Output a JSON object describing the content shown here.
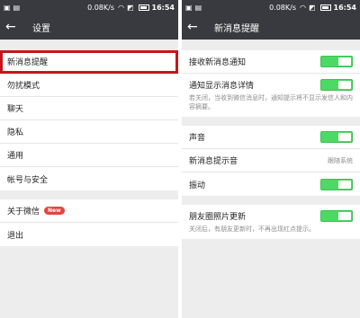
{
  "statusbar": {
    "speed": "0.08K/s",
    "time": "16:54"
  },
  "left": {
    "title": "设置",
    "group1": [
      "新消息提醒",
      "勿扰模式",
      "聊天",
      "隐私",
      "通用",
      "帐号与安全"
    ],
    "group2": {
      "about": "关于微信",
      "badge": "New",
      "logout": "退出"
    }
  },
  "right": {
    "title": "新消息提醒",
    "receive": "接收新消息通知",
    "show_detail": "通知显示消息详情",
    "show_detail_desc": "若关闭，当收到微信消息时，通知提示将不显示发信人和内容摘要。",
    "sound": "声音",
    "tone": "新消息提示音",
    "tone_value": "跟随系统",
    "vibrate": "振动",
    "moments": "朋友圈照片更新",
    "moments_desc": "关闭后，有朋友更新时，不再出现红点提示。"
  },
  "colors": {
    "header": "#393a3f",
    "toggle_on": "#4cd964",
    "highlight": "#c4161c",
    "badge": "#e64340"
  },
  "toggles": {
    "receive": true,
    "show_detail": true,
    "sound": true,
    "vibrate": true,
    "moments": true
  }
}
